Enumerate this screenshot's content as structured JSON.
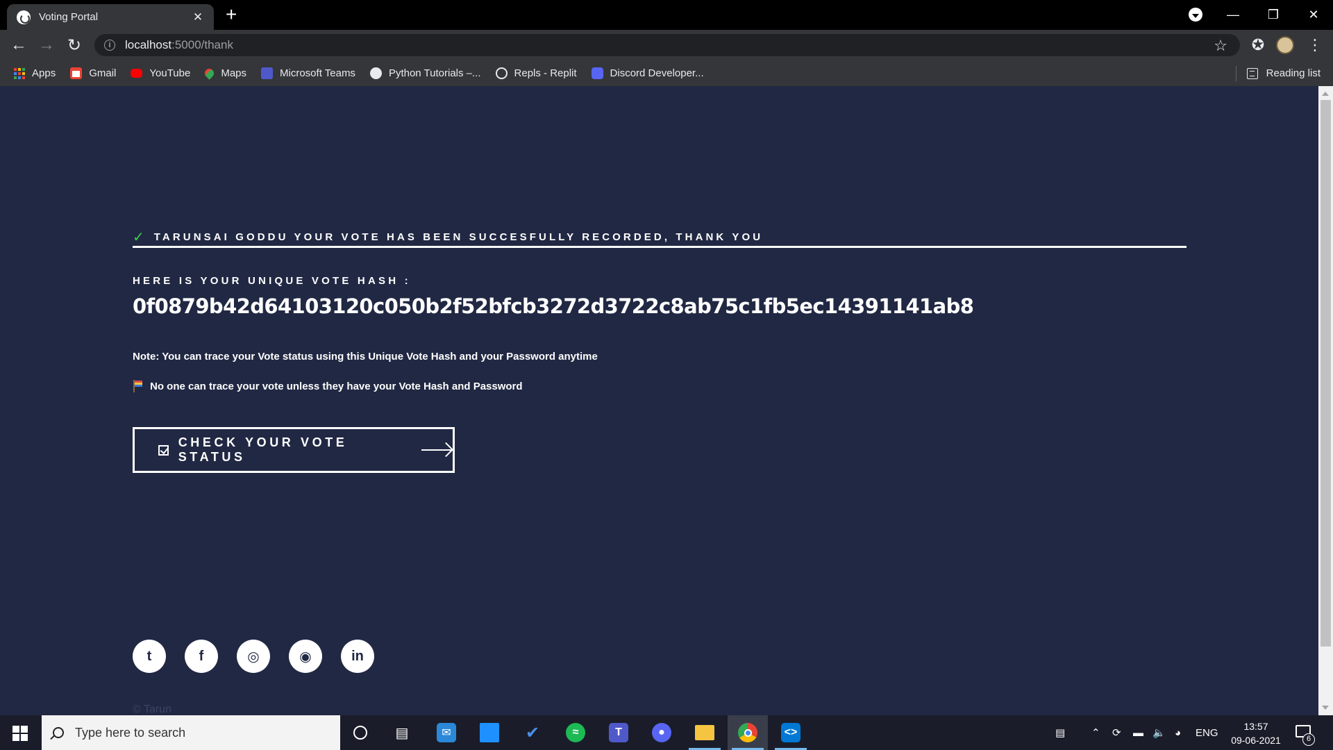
{
  "browser": {
    "tab_title": "Voting Portal",
    "tab_close": "✕",
    "new_tab": "+",
    "url_host": "localhost",
    "url_path": ":5000/thank",
    "bookmarks": [
      {
        "label": "Apps",
        "icon": "apps-grid-icon",
        "color": "#4285f4"
      },
      {
        "label": "Gmail",
        "icon": "gmail-icon",
        "color": "#ea4335"
      },
      {
        "label": "YouTube",
        "icon": "youtube-icon",
        "color": "#ff0000"
      },
      {
        "label": "Maps",
        "icon": "maps-icon",
        "color": "#34a853"
      },
      {
        "label": "Microsoft Teams",
        "icon": "teams-icon",
        "color": "#5059c9"
      },
      {
        "label": "Python Tutorials –...",
        "icon": "python-icon",
        "color": "#e8eaed"
      },
      {
        "label": "Repls - Replit",
        "icon": "replit-icon",
        "color": "#e8eaed"
      },
      {
        "label": "Discord Developer...",
        "icon": "discord-icon",
        "color": "#5865f2"
      }
    ],
    "reading_list": "Reading list"
  },
  "page": {
    "background": "#212843",
    "success_message": "TARUNSAI GODDU YOUR VOTE HAS BEEN SUCCESFULLY RECORDED, THANK YOU",
    "hash_label": "HERE IS YOUR UNIQUE VOTE HASH :",
    "hash_value": "0f0879b42d64103120c050b2f52bfcb3272d3722c8ab75c1fb5ec14391141ab8",
    "note": "Note: You can trace your Vote status using this Unique Vote Hash and your Password anytime",
    "privacy_note": "No one can trace your vote unless they have your Vote Hash and Password",
    "cta_label": "CHECK YOUR VOTE STATUS",
    "social_links": [
      {
        "name": "twitter-icon",
        "glyph": "t"
      },
      {
        "name": "facebook-icon",
        "glyph": "f"
      },
      {
        "name": "instagram-icon",
        "glyph": "◎"
      },
      {
        "name": "github-icon",
        "glyph": "◉"
      },
      {
        "name": "linkedin-icon",
        "glyph": "in"
      }
    ],
    "copyright": "© Tarun"
  },
  "taskbar": {
    "search_placeholder": "Type here to search",
    "language": "ENG",
    "time": "13:57",
    "date": "09-06-2021",
    "notification_count": "6"
  }
}
